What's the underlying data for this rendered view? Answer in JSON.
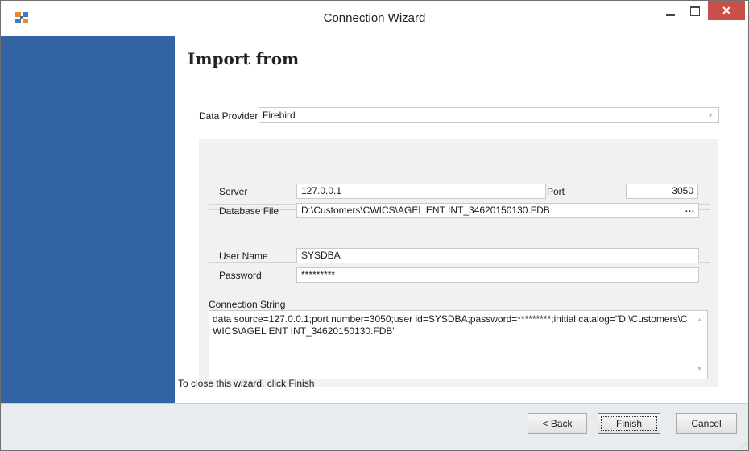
{
  "window": {
    "title": "Connection Wizard"
  },
  "page": {
    "heading": "Import from",
    "footer_hint": "To close this wizard, click Finish"
  },
  "form": {
    "data_provider": {
      "label": "Data Provider",
      "value": "Firebird"
    },
    "server": {
      "label": "Server",
      "value": "127.0.0.1"
    },
    "port": {
      "label": "Port",
      "value": "3050"
    },
    "database_file": {
      "label": "Database File",
      "value": "D:\\Customers\\CWICS\\AGEL ENT INT_34620150130.FDB",
      "browse": "..."
    },
    "user_name": {
      "label": "User Name",
      "value": "SYSDBA"
    },
    "password": {
      "label": "Password",
      "value": "*********"
    },
    "connection_string": {
      "label": "Connection String",
      "value": "data source=127.0.0.1;port number=3050;user id=SYSDBA;password=*********;initial catalog=\"D:\\Customers\\CWICS\\AGEL ENT INT_34620150130.FDB\""
    }
  },
  "buttons": {
    "back": "< Back",
    "finish": "Finish",
    "cancel": "Cancel"
  },
  "icons": {
    "app": "app-icon",
    "minimize": "minimize-icon",
    "maximize": "maximize-icon",
    "close": "close-icon",
    "dropdown": "chevron-down-icon"
  },
  "colors": {
    "side_panel": "#3365a5",
    "close_button": "#c7504a",
    "button_bar": "#e9ecef"
  }
}
